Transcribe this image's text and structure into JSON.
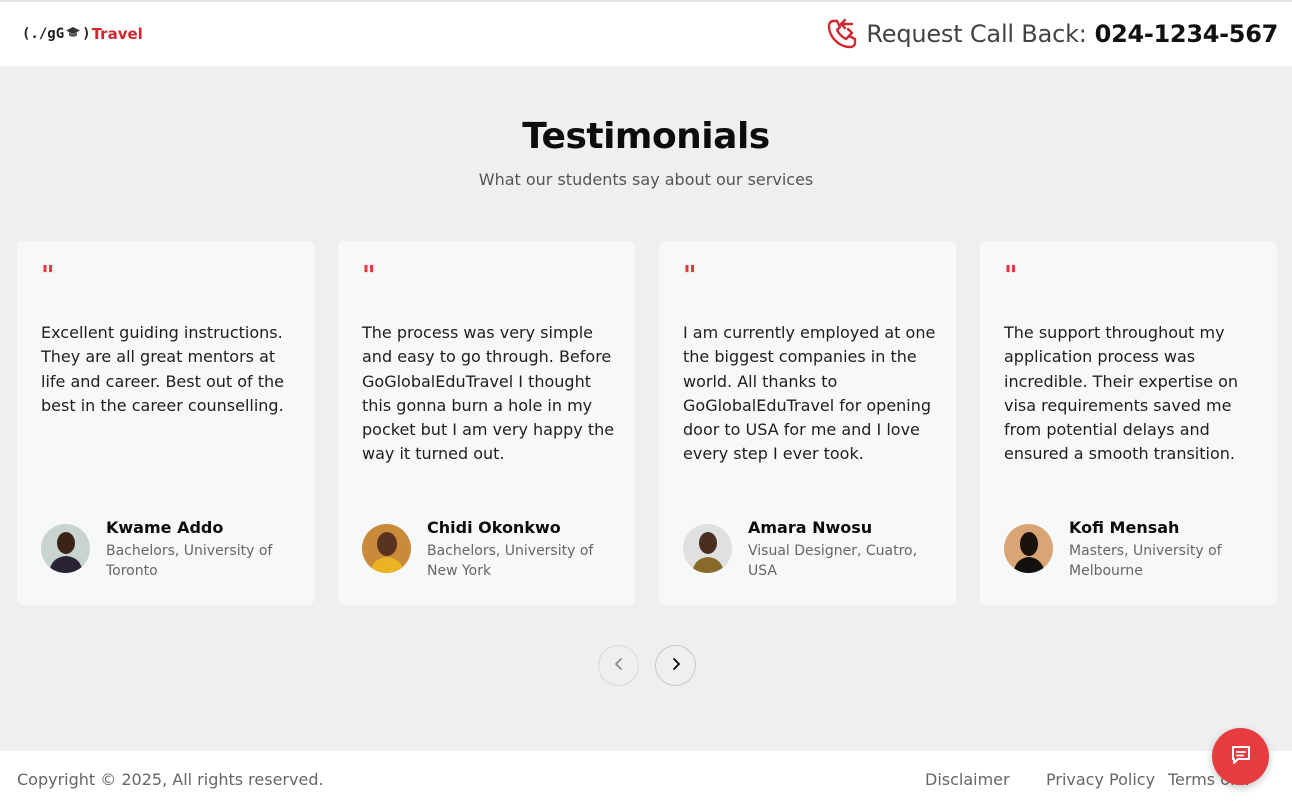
{
  "header": {
    "logo_prefix": "(./gG",
    "logo_suffix": ")",
    "logo_brand": "Travel",
    "callback_label": "Request Call Back:",
    "callback_number": "024-1234-567"
  },
  "section": {
    "title": "Testimonials",
    "subtitle": "What our students say about our services"
  },
  "testimonials": [
    {
      "quote_mark": "\"",
      "text": "Excellent guiding instructions. They are all great mentors at life and career. Best out of the best in the career counselling.",
      "name": "Kwame Addo",
      "role": "Bachelors, University of Toronto"
    },
    {
      "quote_mark": "\"",
      "text": "The process was very simple and easy to go through. Before GoGlobalEduTravel I thought this gonna burn a hole in my pocket but I am very happy the way it turned out.",
      "name": "Chidi Okonkwo",
      "role": "Bachelors, University of New York"
    },
    {
      "quote_mark": "\"",
      "text": "I am currently employed at one the biggest companies in the world. All thanks to GoGlobalEduTravel for opening door to USA for me and I love every step I ever took.",
      "name": "Amara Nwosu",
      "role": "Visual Designer, Cuatro, USA"
    },
    {
      "quote_mark": "\"",
      "text": "The support throughout my application process was incredible. Their expertise on visa requirements saved me from potential delays and ensured a smooth transition.",
      "name": "Kofi Mensah",
      "role": "Masters, University of Melbourne"
    }
  ],
  "carousel": {
    "prev_icon": "chevron-left-icon",
    "next_icon": "chevron-right-icon"
  },
  "footer": {
    "copyright": "Copyright © 2025, All rights reserved.",
    "links": [
      "Disclaimer",
      "Privacy Policy",
      "Terms of..."
    ]
  },
  "colors": {
    "accent": "#e2383d",
    "background": "#eeeff1",
    "card": "#f7f8fa"
  }
}
